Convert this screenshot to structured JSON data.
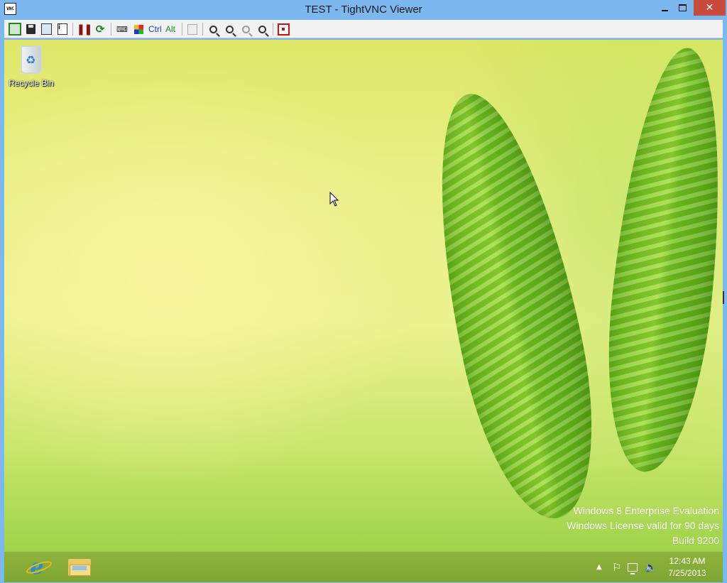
{
  "window": {
    "title": "TEST - TightVNC Viewer",
    "app_icon_text": "VNC",
    "close_glyph": "✕"
  },
  "toolbar": {
    "buttons": [
      {
        "name": "new-connection",
        "icon": "connection-icon"
      },
      {
        "name": "save-session",
        "icon": "save-icon"
      },
      {
        "name": "connection-options",
        "icon": "options-icon"
      },
      {
        "name": "connection-info",
        "icon": "info-icon"
      },
      {
        "name": "pause",
        "icon": "pause-icon"
      },
      {
        "name": "refresh-screen",
        "icon": "refresh-icon"
      },
      {
        "name": "send-ctrl-alt-del",
        "icon": "ctrl-alt-del-icon"
      },
      {
        "name": "send-win-key",
        "icon": "windows-key-icon"
      },
      {
        "name": "ctrl-key",
        "label": "Ctrl"
      },
      {
        "name": "alt-key",
        "label": "Alt"
      },
      {
        "name": "transfer-clipboard",
        "icon": "clipboard-icon"
      },
      {
        "name": "zoom-in",
        "icon": "zoom-in-icon"
      },
      {
        "name": "zoom-out",
        "icon": "zoom-out-icon"
      },
      {
        "name": "zoom-100",
        "icon": "zoom-actual-icon"
      },
      {
        "name": "zoom-fit",
        "icon": "zoom-fit-icon"
      },
      {
        "name": "full-screen",
        "icon": "fullscreen-icon"
      }
    ],
    "ctrl_label": "Ctrl",
    "alt_label": "Alt"
  },
  "desktop": {
    "recycle_bin_label": "Recycle Bin",
    "watermark": {
      "line1": "Windows 8 Enterprise Evaluation",
      "line2": "Windows License valid for 90 days",
      "line3": "Build 9200"
    }
  },
  "taskbar": {
    "pinned": [
      {
        "name": "internet-explorer",
        "icon": "ie-icon",
        "glyph": "e"
      },
      {
        "name": "file-explorer",
        "icon": "folder-icon"
      }
    ],
    "tray": {
      "arrow_glyph": "▲",
      "flag_glyph": "⚐",
      "volume_glyph": "🔈"
    },
    "clock": {
      "time": "12:43 AM",
      "date": "7/25/2013"
    }
  },
  "colors": {
    "titlebar": "#7db7ef",
    "close_button": "#c74a3a",
    "taskbar": "#8fb43c",
    "ctrl_label": "#1a3fae",
    "alt_label": "#1e8a25"
  }
}
